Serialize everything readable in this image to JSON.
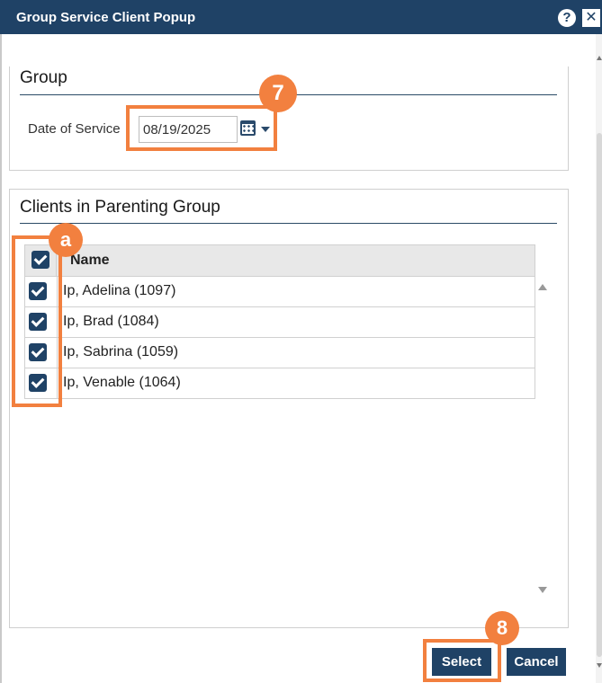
{
  "window": {
    "title": "Group Service Client Popup",
    "help_icon": "?",
    "close_icon": "✕"
  },
  "group_section": {
    "title": "Group",
    "date_label": "Date of Service",
    "date_value": "08/19/2025"
  },
  "clients_section": {
    "title": "Clients in Parenting Group",
    "column_name": "Name",
    "select_all_checked": true,
    "clients": [
      {
        "name": "Ip, Adelina (1097)",
        "checked": true
      },
      {
        "name": "Ip, Brad (1084)",
        "checked": true
      },
      {
        "name": "Ip, Sabrina (1059)",
        "checked": true
      },
      {
        "name": "Ip, Venable (1064)",
        "checked": true
      }
    ]
  },
  "buttons": {
    "select": "Select",
    "cancel": "Cancel"
  },
  "callouts": {
    "step_7": "7",
    "step_a": "a",
    "step_8": "8"
  },
  "colors": {
    "header": "#1f4266",
    "accent": "#f2803f"
  }
}
